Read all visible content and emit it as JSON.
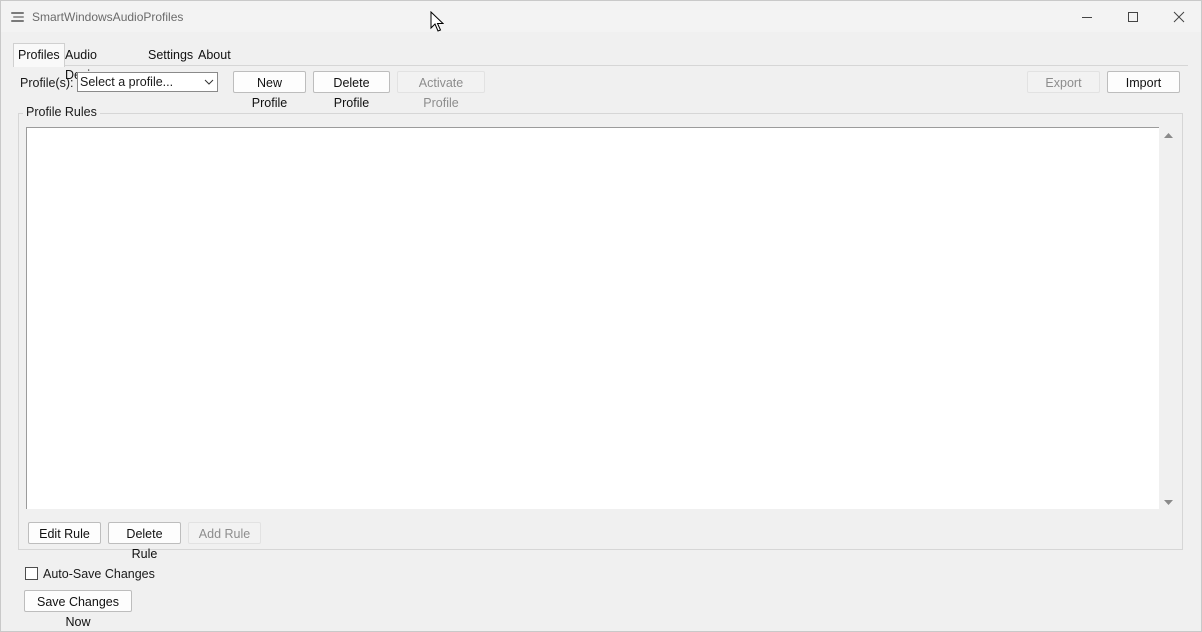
{
  "window": {
    "title": "SmartWindowsAudioProfiles",
    "controls": {
      "minimize": "minimize-icon",
      "maximize": "maximize-icon",
      "close": "close-icon"
    }
  },
  "tabs": [
    {
      "label": "Profiles",
      "active": true
    },
    {
      "label": "Audio Devices",
      "active": false
    },
    {
      "label": "Settings",
      "active": false
    },
    {
      "label": "About",
      "active": false
    }
  ],
  "toolbar": {
    "profiles_label": "Profile(s):",
    "profile_select": {
      "value": "Select a profile..."
    },
    "new_profile": "New Profile",
    "delete_profile": "Delete Profile",
    "activate_profile": {
      "label": "Activate Profile",
      "enabled": false
    },
    "export": {
      "label": "Export",
      "enabled": false
    },
    "import": "Import"
  },
  "profile_rules": {
    "title": "Profile Rules",
    "rules": [],
    "edit_rule": "Edit Rule",
    "delete_rule": "Delete Rule",
    "add_rule": {
      "label": "Add Rule",
      "enabled": false
    }
  },
  "footer": {
    "auto_save": {
      "label": "Auto-Save Changes",
      "checked": false
    },
    "save_now": "Save Changes Now"
  }
}
